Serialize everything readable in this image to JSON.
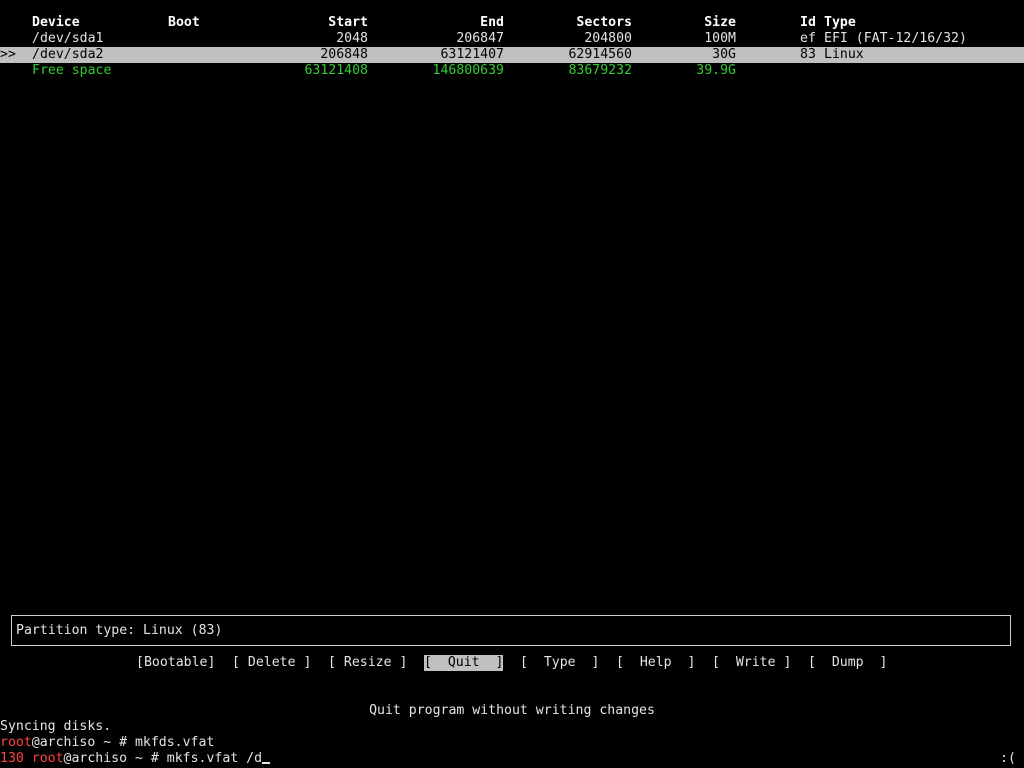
{
  "table": {
    "headers": {
      "device": "Device",
      "boot": "Boot",
      "start": "Start",
      "end": "End",
      "sectors": "Sectors",
      "size": "Size",
      "id": "Id",
      "type": "Type"
    },
    "rows": [
      {
        "marker": "",
        "device": "/dev/sda1",
        "boot": "",
        "start": "2048",
        "end": "206847",
        "sectors": "204800",
        "size": "100M",
        "id": "ef",
        "type": "EFI (FAT-12/16/32)"
      },
      {
        "marker": ">>",
        "device": "/dev/sda2",
        "boot": "",
        "start": "206848",
        "end": "63121407",
        "sectors": "62914560",
        "size": "30G",
        "id": "83",
        "type": "Linux"
      },
      {
        "marker": "",
        "device": "Free space",
        "boot": "",
        "start": "63121408",
        "end": "146800639",
        "sectors": "83679232",
        "size": "39.9G",
        "id": "",
        "type": ""
      }
    ],
    "selected_index": 1
  },
  "info": {
    "partition_type": "Partition type: Linux (83)"
  },
  "menu": {
    "bootable": "[Bootable]",
    "delete": "[ Delete ]",
    "resize": "[ Resize ]",
    "quit": "[  Quit  ]",
    "type": "[  Type  ]",
    "help": "[  Help  ]",
    "write": "[  Write ]",
    "dump": "[  Dump  ]",
    "active": "quit"
  },
  "hint": "Quit program without writing changes",
  "terminal": {
    "line1": "Syncing disks.",
    "line2_user": "root",
    "line2_rest": "@archiso ~ # mkfds.vfat",
    "line3_code": "130",
    "line3_user": "root",
    "line3_rest": "@archiso ~ # mkfs.vfat /d",
    "status": ":("
  },
  "colors": {
    "background": "#000000",
    "text": "#e4e4e4",
    "selected_bg": "#c0c0c0",
    "free_space": "#33cc33",
    "prompt_red": "#ff4444"
  }
}
